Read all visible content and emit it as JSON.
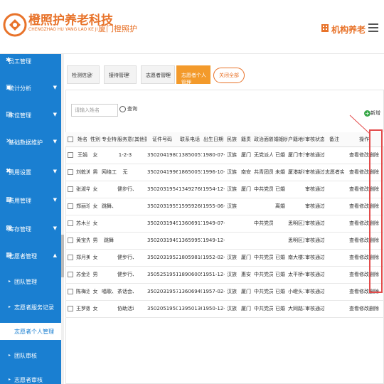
{
  "header": {
    "brand_cn": "橙照护养老科技",
    "brand_en": "CHENGZHAO HU YANG LAO KE JI",
    "system_name": "厦门橙照护",
    "org_name": "机构养老",
    "accent_color": "#e8732a"
  },
  "sidebar": {
    "items": [
      {
        "label": "员工管理",
        "icon": "user-icon"
      },
      {
        "label": "统计分析",
        "icon": "chart-icon"
      },
      {
        "label": "床位管理",
        "icon": "bed-icon"
      },
      {
        "label": "基础数据维护",
        "icon": "database-icon"
      },
      {
        "label": "费用设置",
        "icon": "money-icon"
      },
      {
        "label": "费用管理",
        "icon": "wallet-icon"
      },
      {
        "label": "库存管理",
        "icon": "box-icon"
      },
      {
        "label": "志愿者管理",
        "icon": "volunteer-icon"
      }
    ],
    "subitems": [
      {
        "label": "团队管理"
      },
      {
        "label": "志愿者服务记录"
      },
      {
        "label": "志愿者个人管理"
      },
      {
        "label": "团队审核"
      },
      {
        "label": "志愿者审核"
      }
    ]
  },
  "tabs": [
    {
      "label": "检测信息",
      "close": "×"
    },
    {
      "label": "接待管理",
      "close": "×"
    },
    {
      "label": "志愿者管理",
      "close": "×"
    },
    {
      "label": "志愿者个人管理",
      "close": ""
    }
  ],
  "close_all_label": "关闭全部",
  "search": {
    "placeholder": "请输入姓名",
    "button_label": "查询"
  },
  "add_label": "新增",
  "table": {
    "headers": [
      "姓名",
      "性别",
      "专业特长",
      "服务意向",
      "其他要求",
      "证件号码",
      "联系电话",
      "出生日期",
      "民族",
      "籍贯",
      "政治面貌",
      "婚姻状况",
      "户籍地址",
      "审核状态",
      "备注",
      "操作"
    ],
    "rows": [
      [
        "王娟",
        "女",
        "",
        "1-2-3",
        "",
        "35020419800724",
        "13850057551",
        "1980-07-24",
        "汉族",
        "厦门",
        "无党派人士",
        "已婚",
        "厦门市思",
        "审核通过",
        ""
      ],
      [
        "刘乾涛",
        "男",
        "网络工程",
        "无",
        "",
        "35020419961026",
        "18650053855",
        "1996-10-26",
        "汉族",
        "南安",
        "共青团员",
        "未婚",
        "厦港新村",
        "审核通过",
        "志愿者实"
      ],
      [
        "张淑华",
        "女",
        "",
        "健步行、",
        "",
        "35020319541215",
        "13492768209",
        "1954-12-15",
        "汉族",
        "厦门",
        "中共党员",
        "已婚",
        "",
        "审核通过",
        ""
      ],
      [
        "郑丽珍",
        "女",
        "跳舞、健",
        "",
        "",
        "35020319550615",
        "15959268888",
        "1955-06-15",
        "汉族",
        "",
        "",
        "离婚",
        "",
        "审核通过",
        ""
      ],
      [
        "苏木兰",
        "女",
        "",
        "",
        "",
        "35020319490716",
        "13606917406",
        "1949-07-16",
        "",
        "",
        "中共党员",
        "",
        "思明区夏",
        "审核通过",
        ""
      ],
      [
        "黄宝先",
        "男",
        "跳舞",
        "",
        "",
        "35020319491217",
        "13659951978",
        "1949-12-17",
        "",
        "",
        "",
        "",
        "思明区夏",
        "审核通过",
        ""
      ],
      [
        "郑月美",
        "女",
        "",
        "健步行、",
        "",
        "35020319520220",
        "18059810402",
        "1952-02-20",
        "汉族",
        "厦门",
        "中共党员",
        "已婚",
        "南大楼3",
        "审核通过",
        ""
      ],
      [
        "苏金治",
        "男",
        "",
        "健步行、",
        "",
        "35052519511207",
        "18906005178",
        "1951-12-07",
        "汉族",
        "惠安",
        "中共党员",
        "已婚",
        "太平桥4",
        "审核通过",
        ""
      ],
      [
        "陈梅治",
        "女",
        "唱歌、跳",
        "茶话会、",
        "",
        "35020319570219",
        "13606949743",
        "1957-02-19",
        "汉族",
        "厦门",
        "中共党员",
        "已婚",
        "小嶝头16",
        "审核通过",
        ""
      ],
      [
        "王罗娜",
        "女",
        "",
        "协助活动",
        "",
        "35020519501202",
        "13950136208",
        "1950-12-02",
        "汉族",
        "厦门",
        "中共党员",
        "已婚",
        "大同路35",
        "审核通过",
        ""
      ]
    ],
    "actions": [
      "查看",
      "修改",
      "删除"
    ]
  }
}
